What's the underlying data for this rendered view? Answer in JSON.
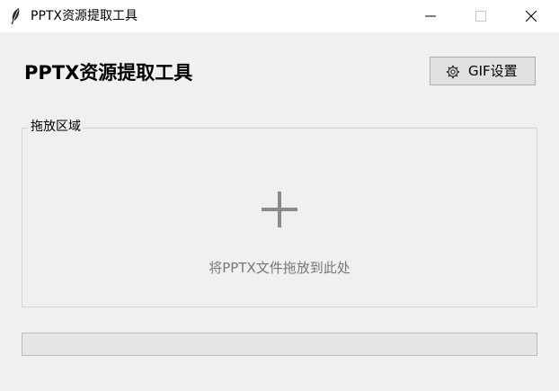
{
  "window": {
    "title": "PPTX资源提取工具",
    "app_icon": "feather-icon",
    "controls": [
      "minimize-icon",
      "maximize-icon",
      "close-icon"
    ]
  },
  "header": {
    "title": "PPTX资源提取工具",
    "gif_button_label": "GIF设置",
    "gif_button_icon": "gear-icon"
  },
  "drop_area": {
    "legend": "拖放区域",
    "icon": "plus-icon",
    "hint": "将PPTX文件拖放到此处"
  },
  "progress": {
    "value": 0
  },
  "colors": {
    "background": "#f0f0f0",
    "hint_text": "#777777",
    "plus": "#8a8a8a"
  }
}
